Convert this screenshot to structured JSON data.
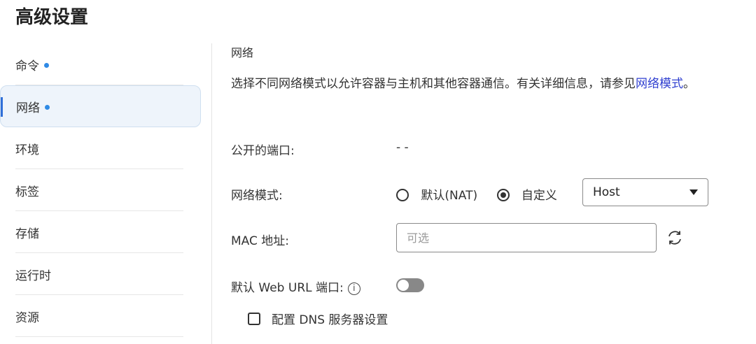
{
  "page": {
    "title": "高级设置"
  },
  "sidebar": {
    "items": [
      {
        "label": "命令",
        "dot": true,
        "active": false
      },
      {
        "label": "网络",
        "dot": true,
        "active": true
      },
      {
        "label": "环境",
        "dot": false,
        "active": false
      },
      {
        "label": "标签",
        "dot": false,
        "active": false
      },
      {
        "label": "存储",
        "dot": false,
        "active": false
      },
      {
        "label": "运行时",
        "dot": false,
        "active": false
      },
      {
        "label": "资源",
        "dot": false,
        "active": false
      }
    ]
  },
  "network": {
    "section_title": "网络",
    "description_text": "选择不同网络模式以允许容器与主机和其他容器通信。有关详细信息，请参见",
    "description_link": "网络模式",
    "description_end": "。",
    "ports": {
      "label": "公开的端口:",
      "value": "- -"
    },
    "mode": {
      "label": "网络模式:",
      "option_default": "默认(NAT)",
      "option_custom": "自定义",
      "selected_option": "custom",
      "custom_value": "Host"
    },
    "mac": {
      "label": "MAC 地址:",
      "placeholder": "可选"
    },
    "web_url": {
      "label": "默认 Web URL 端口:",
      "enabled": false
    },
    "dns": {
      "label": "配置 DNS 服务器设置",
      "checked": false
    }
  },
  "icons": {
    "info": "info-icon",
    "refresh": "refresh-icon",
    "dropdown": "caret-down-icon"
  },
  "colors": {
    "accent": "#2f6fd8",
    "dot": "#2f8ae5",
    "link": "#2f3fd0",
    "active_bg": "#eef4fb",
    "toggle_off": "#888888",
    "warning": "#c56b12"
  }
}
